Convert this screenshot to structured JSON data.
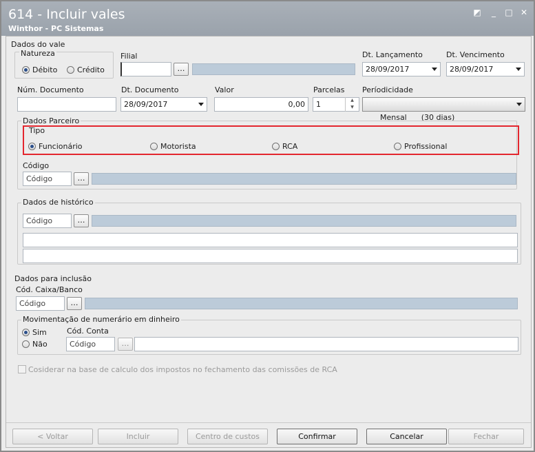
{
  "window": {
    "title": "614 - Incluir vales",
    "subtitle": "Winthor - PC Sistemas"
  },
  "dados_vale": {
    "legend": "Dados do vale",
    "natureza": {
      "legend": "Natureza",
      "options": [
        "Débito",
        "Crédito"
      ],
      "selected": "Débito"
    },
    "filial": {
      "label": "Filial",
      "value": ""
    },
    "dt_lancamento": {
      "label": "Dt. Lançamento",
      "value": "28/09/2017"
    },
    "dt_vencimento": {
      "label": "Dt. Vencimento",
      "value": "28/09/2017"
    },
    "num_documento": {
      "label": "Núm. Documento",
      "value": ""
    },
    "dt_documento": {
      "label": "Dt. Documento",
      "value": "28/09/2017"
    },
    "valor": {
      "label": "Valor",
      "value": "0,00"
    },
    "parcelas": {
      "label": "Parcelas",
      "value": "1"
    },
    "periodicidade": {
      "label": "Períodicidade",
      "value": "Mensal      (30 dias)"
    }
  },
  "dados_parceiro": {
    "legend": "Dados Parceiro",
    "tipo": {
      "legend": "Tipo",
      "options": [
        "Funcionário",
        "Motorista",
        "RCA",
        "Profissional"
      ],
      "selected": "Funcionário"
    },
    "codigo": {
      "label": "Código",
      "placeholder": "Código"
    }
  },
  "dados_historico": {
    "legend": "Dados de histórico",
    "codigo": {
      "placeholder": "Código"
    }
  },
  "dados_inclusao": {
    "legend": "Dados para inclusão",
    "caixa_banco": {
      "label": "Cód. Caixa/Banco",
      "placeholder": "Código"
    },
    "movimentacao": {
      "legend": "Movimentação de numerário em dinheiro",
      "options": [
        "Sim",
        "Não"
      ],
      "selected": "Sim",
      "conta": {
        "label": "Cód. Conta",
        "placeholder": "Código"
      }
    }
  },
  "checkbox_label": "Cosiderar na base de calculo dos impostos no fechamento das comissões de RCA",
  "buttons": {
    "voltar": "< Voltar",
    "incluir": "Incluir",
    "centro_custos": "Centro de custos",
    "confirmar": "Confirmar",
    "cancelar": "Cancelar",
    "fechar": "Fechar"
  },
  "icons": {
    "titlebar": [
      "pin-icon",
      "minimize-icon",
      "maximize-icon",
      "close-icon"
    ],
    "combo": "chevron-down-icon",
    "lookup": "ellipsis-icon"
  }
}
